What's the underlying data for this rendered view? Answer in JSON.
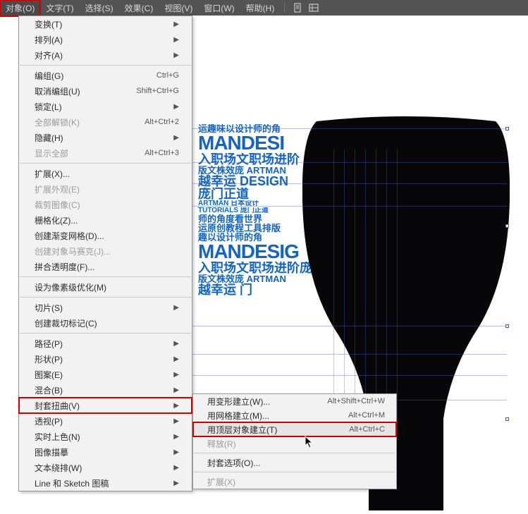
{
  "menubar": {
    "items": [
      {
        "label": "对象(O)",
        "active": true,
        "highlighted": true
      },
      {
        "label": "文字(T)"
      },
      {
        "label": "选择(S)"
      },
      {
        "label": "效果(C)"
      },
      {
        "label": "视图(V)"
      },
      {
        "label": "窗口(W)"
      },
      {
        "label": "帮助(H)"
      }
    ]
  },
  "dropdown": {
    "groups": [
      [
        {
          "label": "变换(T)",
          "arrow": true
        },
        {
          "label": "排列(A)",
          "arrow": true
        },
        {
          "label": "对齐(A)",
          "arrow": true
        }
      ],
      [
        {
          "label": "编组(G)",
          "shortcut": "Ctrl+G"
        },
        {
          "label": "取消编组(U)",
          "shortcut": "Shift+Ctrl+G"
        },
        {
          "label": "锁定(L)",
          "arrow": true
        },
        {
          "label": "全部解锁(K)",
          "shortcut": "Alt+Ctrl+2",
          "disabled": true
        },
        {
          "label": "隐藏(H)",
          "arrow": true
        },
        {
          "label": "显示全部",
          "shortcut": "Alt+Ctrl+3",
          "disabled": true
        }
      ],
      [
        {
          "label": "扩展(X)..."
        },
        {
          "label": "扩展外观(E)",
          "disabled": true
        },
        {
          "label": "裁剪图像(C)",
          "disabled": true
        },
        {
          "label": "栅格化(Z)..."
        },
        {
          "label": "创建渐变网格(D)..."
        },
        {
          "label": "创建对象马赛克(J)...",
          "disabled": true
        },
        {
          "label": "拼合透明度(F)..."
        }
      ],
      [
        {
          "label": "设为像素级优化(M)"
        }
      ],
      [
        {
          "label": "切片(S)",
          "arrow": true
        },
        {
          "label": "创建裁切标记(C)"
        }
      ],
      [
        {
          "label": "路径(P)",
          "arrow": true
        },
        {
          "label": "形状(P)",
          "arrow": true
        },
        {
          "label": "图案(E)",
          "arrow": true
        },
        {
          "label": "混合(B)",
          "arrow": true
        },
        {
          "label": "封套扭曲(V)",
          "arrow": true,
          "highlighted": true
        },
        {
          "label": "透视(P)",
          "arrow": true
        },
        {
          "label": "实时上色(N)",
          "arrow": true
        },
        {
          "label": "图像描摹",
          "arrow": true
        },
        {
          "label": "文本绕排(W)",
          "arrow": true
        },
        {
          "label": "Line 和 Sketch 图稿",
          "arrow": true
        }
      ]
    ]
  },
  "submenu": {
    "groups": [
      [
        {
          "label": "用变形建立(W)...",
          "shortcut": "Alt+Shift+Ctrl+W"
        },
        {
          "label": "用网格建立(M)...",
          "shortcut": "Alt+Ctrl+M"
        },
        {
          "label": "用顶层对象建立(T)",
          "shortcut": "Alt+Ctrl+C",
          "highlighted": true
        },
        {
          "label": "释放(R)",
          "disabled": true
        }
      ],
      [
        {
          "label": "封套选项(O)..."
        }
      ],
      [
        {
          "label": "扩展(X)",
          "disabled": true
        }
      ]
    ]
  },
  "canvas_text": {
    "r1": "运趣味以设计师的角",
    "r2": "MANDESI",
    "r3": "入职场文职场进阶",
    "r4": "版文株效庞 ARTMAN",
    "r5": "越幸运 DESIGN",
    "r6": "庞门正道",
    "r7": "ARTMAN 日本设计",
    "r8": "TUTORIALS 庞门正道",
    "r9": "师的角度看世界",
    "r10": "运原创教程工具排版",
    "r11": "趣以设计师的角",
    "r12": "MANDESIG",
    "r13": "入职场文职场进阶庞",
    "r14": "版文株效庞 ARTMAN",
    "r15": "越幸运 门"
  }
}
